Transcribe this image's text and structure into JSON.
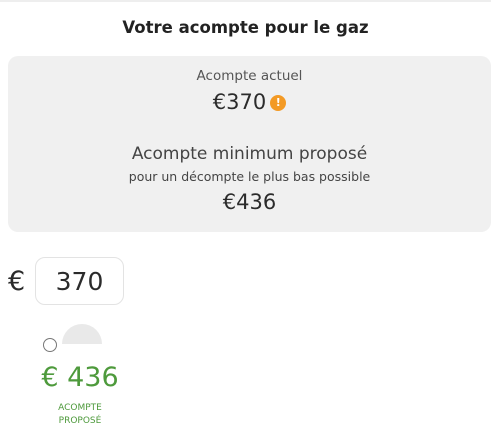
{
  "title": "Votre acompte pour le gaz",
  "current": {
    "label": "Acompte actuel",
    "value": "€370",
    "warning_icon": "exclamation-icon",
    "warning_glyph": "!",
    "warning_color": "#f39a25"
  },
  "minimum": {
    "label": "Acompte minimum proposé",
    "sublabel": "pour un décompte le plus bas possible",
    "value": "€436"
  },
  "input": {
    "currency": "€",
    "value": "370"
  },
  "proposed": {
    "value": "€ 436",
    "label_line1": "ACOMPTE",
    "label_line2": "PROPOSÉ",
    "color": "#4e9a3c"
  }
}
